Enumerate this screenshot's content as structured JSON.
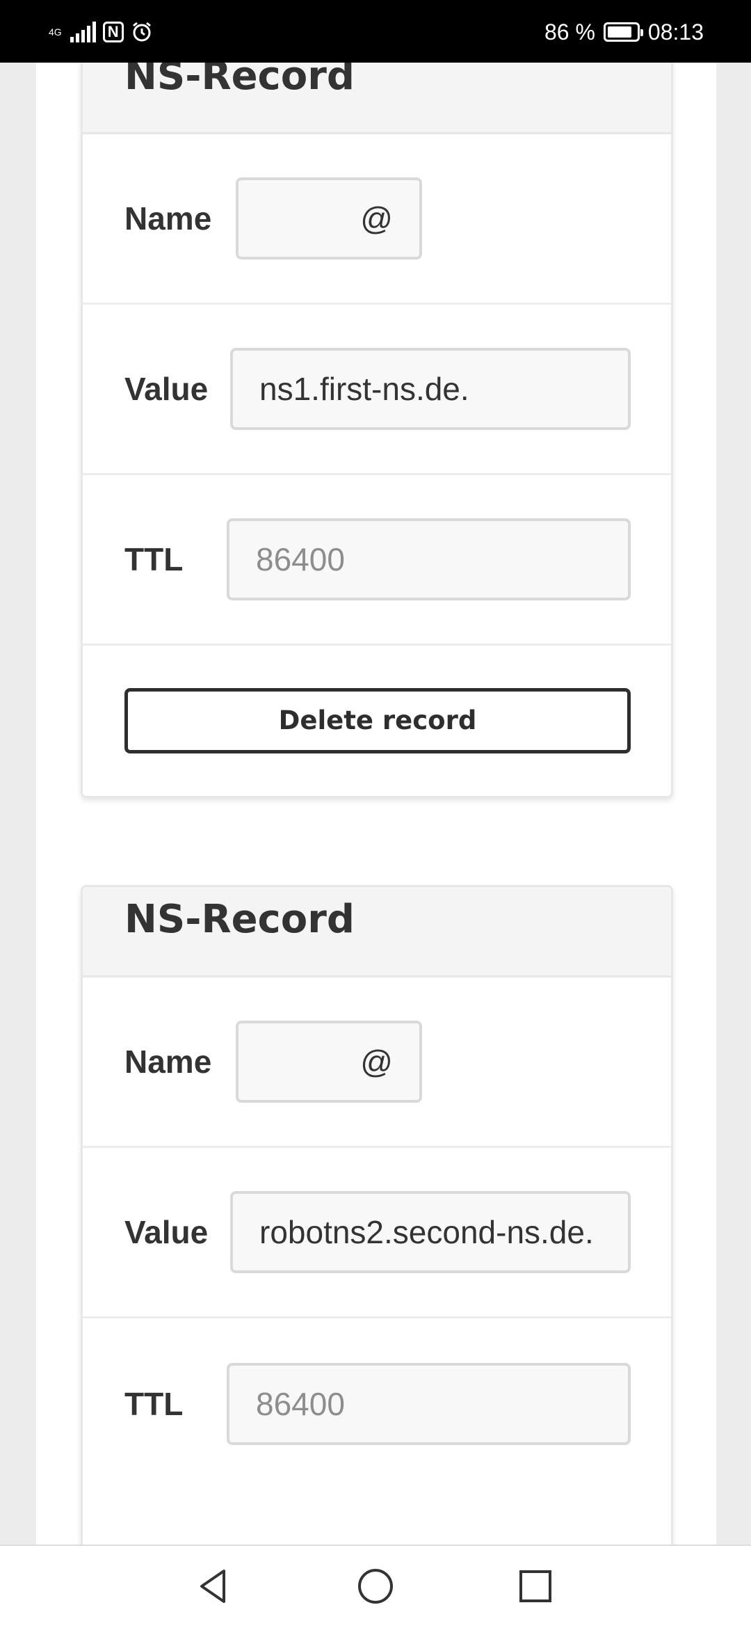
{
  "status_bar": {
    "network": "4G",
    "battery_percent": "86 %",
    "battery_level": 0.86,
    "time": "08:13",
    "icons": [
      "signal-icon",
      "nfc-icon",
      "alarm-icon",
      "battery-icon"
    ]
  },
  "records": [
    {
      "title": "NS-Record",
      "name_label": "Name",
      "name_value": "@",
      "value_label": "Value",
      "value_value": "ns1.first-ns.de.",
      "ttl_label": "TTL",
      "ttl_placeholder": "86400",
      "delete_label": "Delete record"
    },
    {
      "title": "NS-Record",
      "name_label": "Name",
      "name_value": "@",
      "value_label": "Value",
      "value_value": "robotns2.second-ns.de.",
      "ttl_label": "TTL",
      "ttl_placeholder": "86400"
    }
  ],
  "nav_bar": {
    "icons": [
      "back-icon",
      "home-icon",
      "recent-apps-icon"
    ]
  }
}
